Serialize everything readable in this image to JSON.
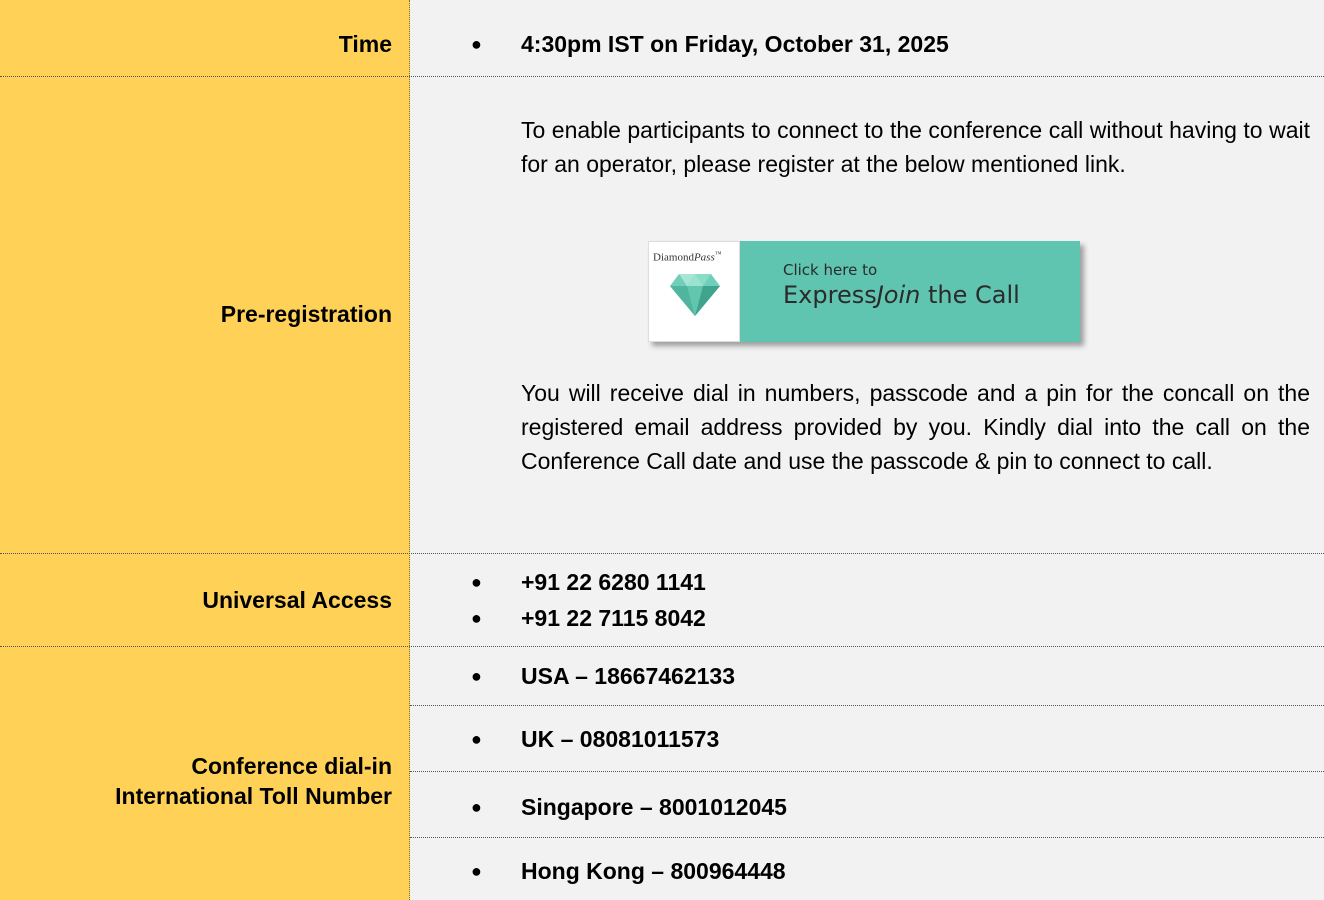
{
  "rows": {
    "time": {
      "label": "Time",
      "value": "4:30pm IST on Friday, October 31, 2025"
    },
    "preregistration": {
      "label": "Pre-registration",
      "intro": "To enable participants to connect to the conference call without having to wait for an operator, please register at the below mentioned link.",
      "banner": {
        "brand": "Diamond",
        "brand_italic": "Pass",
        "brand_tm": "™",
        "line1": "Click here to",
        "line2_a": "Express",
        "line2_b": "Join",
        "line2_c": " the Call"
      },
      "outro": "You will receive dial in numbers, passcode and a pin for the concall on the registered email address provided by you. Kindly dial into the call on the Conference Call date and use the passcode & pin to connect to call."
    },
    "universal": {
      "label": "Universal Access",
      "numbers": [
        "+91 22 6280 1141",
        "+91 22 7115 8042"
      ]
    },
    "conference": {
      "label_line1": "Conference dial-in",
      "label_line2": "International Toll Number",
      "numbers": [
        "USA – 18667462133",
        "UK – 08081011573",
        "Singapore – 8001012045",
        "Hong Kong – 800964448"
      ]
    }
  },
  "bullet": "●",
  "colors": {
    "label_bg": "#ffd257",
    "value_bg": "#f2f2f2",
    "banner_teal": "#5fc4b0"
  }
}
